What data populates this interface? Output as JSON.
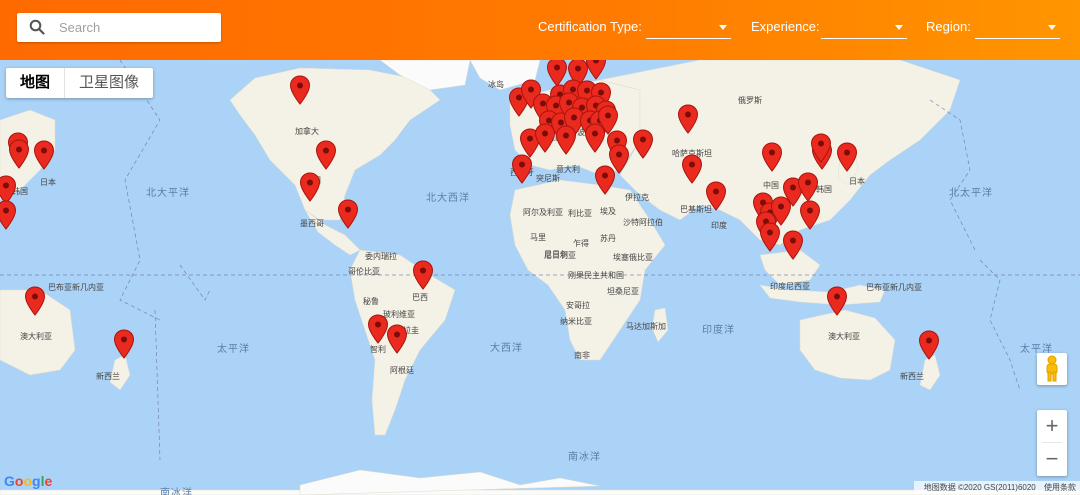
{
  "search": {
    "placeholder": "Search"
  },
  "filters": [
    {
      "label": "Certification Type:",
      "value": ""
    },
    {
      "label": "Experience:",
      "value": ""
    },
    {
      "label": "Region:",
      "value": ""
    }
  ],
  "map_type": {
    "map": "地图",
    "satellite": "卫星图像"
  },
  "ocean_labels": [
    "北大平洋",
    "北大西洋",
    "北太平洋",
    "太平洋",
    "大西洋",
    "印度洋",
    "太平洋",
    "南冰洋",
    "南冰洋"
  ],
  "place_labels": [
    "冰岛",
    "俄罗斯",
    "加拿大",
    "美国",
    "墨西哥",
    "哈萨克斯坦",
    "中国",
    "韩国",
    "日本",
    "阿尔及利亚",
    "利比亚",
    "埃及",
    "伊拉克",
    "沙特阿拉伯",
    "巴基斯坦",
    "印度",
    "马里",
    "尼日尔",
    "乍得",
    "苏丹",
    "尼日利亚",
    "埃塞俄比亚",
    "刚果民主共和国",
    "坦桑尼亚",
    "安哥拉",
    "纳米比亚",
    "南非",
    "马达加斯加",
    "委内瑞拉",
    "哥伦比亚",
    "秘鲁",
    "巴西",
    "玻利维亚",
    "巴拉圭",
    "智利",
    "阿根廷",
    "巴布亚新几内亚",
    "印度尼西亚",
    "澳大利亚",
    "新西兰",
    "日本",
    "韩国",
    "突尼斯",
    "西班牙",
    "德国",
    "意大利",
    "波兰",
    "巴布亚新几内亚",
    "澳大利亚",
    "新西兰"
  ],
  "icons": {
    "search": "search-icon",
    "pin": "map-pin-icon",
    "pegman": "pegman-icon",
    "caret": "dropdown-caret-icon"
  },
  "marker_count_label": "",
  "zoom": {
    "in": "+",
    "out": "−"
  },
  "attribution": {
    "data": "地图数据 ©2020 GS(2011)6020",
    "terms": "使用条款"
  },
  "logo": "Google",
  "colors": {
    "topbar": "#ff7a00",
    "ocean": "#aad3f7",
    "land": "#f4f1e6",
    "pin": "#ea2a1e"
  }
}
